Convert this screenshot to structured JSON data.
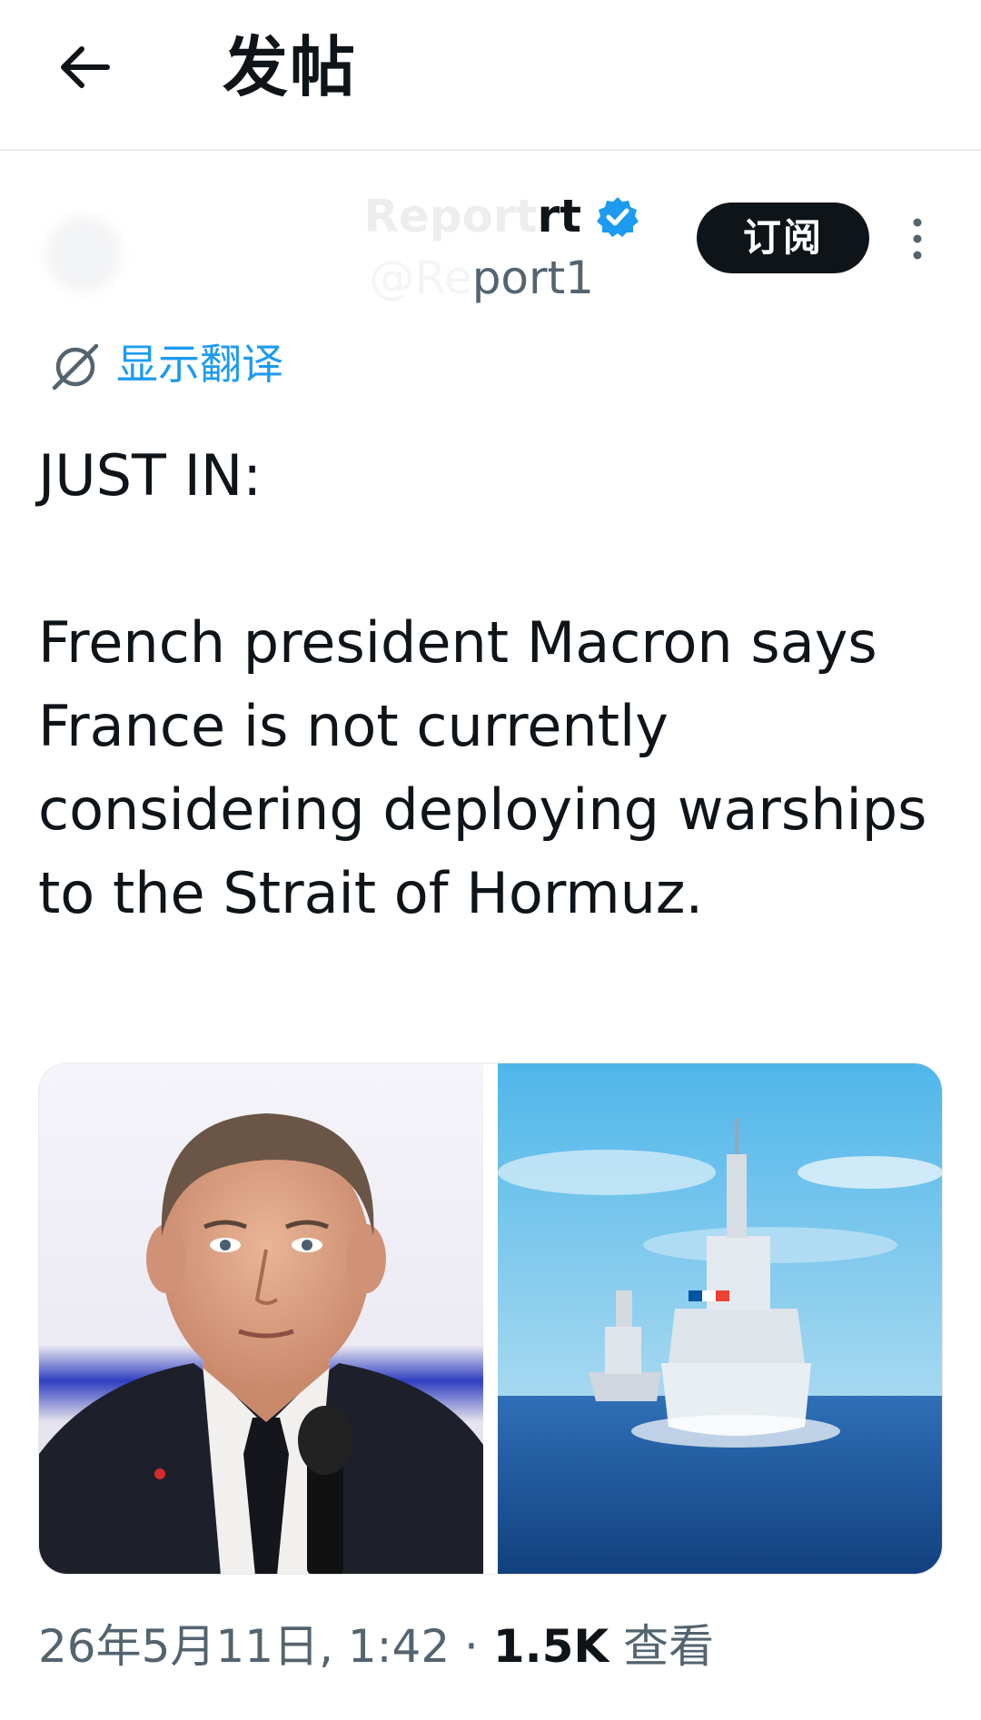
{
  "header": {
    "title": "发帖"
  },
  "author": {
    "name_visible": "rt",
    "handle_visible": "port1",
    "name_faded": "Report",
    "handle_faded": "@Re"
  },
  "subscribe_label": "订阅",
  "translate_label": "显示翻译",
  "tweet": {
    "line1": "JUST IN:",
    "line2": "French president Macron says France is not currently considering deploying warships to the Strait of Hormuz."
  },
  "meta": {
    "date": "26年5月11日, 1:42",
    "separator": "·",
    "views_count": "1.5K",
    "views_label": "查看"
  },
  "colors": {
    "accent": "#1d9bf0",
    "text": "#0f1419",
    "secondary": "#536471"
  },
  "icons": [
    "back-arrow-icon",
    "verified-badge-icon",
    "more-options-icon",
    "translate-globe-icon"
  ]
}
